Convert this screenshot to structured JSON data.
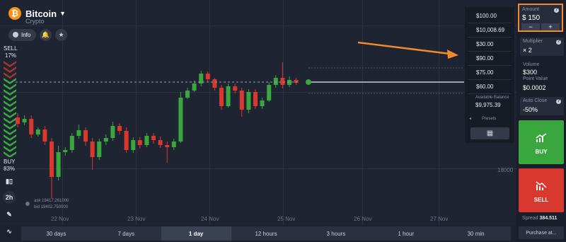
{
  "asset": {
    "name": "Bitcoin",
    "category": "Crypto",
    "logo_glyph": "₿"
  },
  "toolbar": {
    "info_label": "Info",
    "bell_icon": "bell-icon",
    "star_icon": "star-icon"
  },
  "sentiment": {
    "sell_label": "SELL",
    "sell_pct": "17%",
    "buy_label": "BUY",
    "buy_pct": "83%",
    "sell_color": "#a3332c",
    "buy_color": "#3aa63e"
  },
  "side_tools": {
    "timeframe": "2h"
  },
  "chart": {
    "x_labels": [
      "22 Nov",
      "23 Nov",
      "24 Nov",
      "25 Nov",
      "26 Nov",
      "27 Nov"
    ],
    "price_label": "18000",
    "ask": "ask 19417.261000",
    "bid": "bid 19402.750000"
  },
  "chart_data": {
    "type": "candlestick",
    "candles": [
      {
        "o": 166,
        "c": 175,
        "h": 160,
        "l": 180
      },
      {
        "o": 173,
        "c": 168,
        "h": 163,
        "l": 177
      },
      {
        "o": 168,
        "c": 190,
        "h": 163,
        "l": 195
      },
      {
        "o": 190,
        "c": 183,
        "h": 180,
        "l": 193
      },
      {
        "o": 183,
        "c": 200,
        "h": 178,
        "l": 205
      },
      {
        "o": 200,
        "c": 250,
        "h": 195,
        "l": 280
      },
      {
        "o": 250,
        "c": 215,
        "h": 206,
        "l": 255
      },
      {
        "o": 215,
        "c": 212,
        "h": 208,
        "l": 220
      },
      {
        "o": 212,
        "c": 192,
        "h": 188,
        "l": 216
      },
      {
        "o": 192,
        "c": 184,
        "h": 176,
        "l": 196
      },
      {
        "o": 184,
        "c": 200,
        "h": 180,
        "l": 206
      },
      {
        "o": 200,
        "c": 222,
        "h": 195,
        "l": 240
      },
      {
        "o": 222,
        "c": 200,
        "h": 196,
        "l": 226
      },
      {
        "o": 200,
        "c": 195,
        "h": 190,
        "l": 205
      },
      {
        "o": 195,
        "c": 178,
        "h": 172,
        "l": 199
      },
      {
        "o": 178,
        "c": 185,
        "h": 174,
        "l": 190
      },
      {
        "o": 185,
        "c": 212,
        "h": 180,
        "l": 216
      },
      {
        "o": 212,
        "c": 198,
        "h": 194,
        "l": 216
      },
      {
        "o": 198,
        "c": 205,
        "h": 194,
        "l": 210
      },
      {
        "o": 205,
        "c": 192,
        "h": 188,
        "l": 208
      },
      {
        "o": 192,
        "c": 198,
        "h": 188,
        "l": 203
      },
      {
        "o": 198,
        "c": 205,
        "h": 193,
        "l": 209
      },
      {
        "o": 205,
        "c": 208,
        "h": 200,
        "l": 230
      },
      {
        "o": 208,
        "c": 200,
        "h": 196,
        "l": 212
      },
      {
        "o": 200,
        "c": 138,
        "h": 130,
        "l": 202
      },
      {
        "o": 138,
        "c": 128,
        "h": 124,
        "l": 140
      },
      {
        "o": 128,
        "c": 118,
        "h": 114,
        "l": 130
      },
      {
        "o": 118,
        "c": 104,
        "h": 100,
        "l": 122
      },
      {
        "o": 104,
        "c": 112,
        "h": 101,
        "l": 116
      },
      {
        "o": 112,
        "c": 124,
        "h": 110,
        "l": 128
      },
      {
        "o": 124,
        "c": 150,
        "h": 120,
        "l": 155
      },
      {
        "o": 150,
        "c": 122,
        "h": 118,
        "l": 152
      },
      {
        "o": 122,
        "c": 128,
        "h": 118,
        "l": 132
      },
      {
        "o": 128,
        "c": 155,
        "h": 124,
        "l": 165
      },
      {
        "o": 155,
        "c": 130,
        "h": 126,
        "l": 160
      },
      {
        "o": 130,
        "c": 150,
        "h": 126,
        "l": 154
      },
      {
        "o": 150,
        "c": 142,
        "h": 138,
        "l": 154
      },
      {
        "o": 142,
        "c": 120,
        "h": 116,
        "l": 144
      },
      {
        "o": 120,
        "c": 110,
        "h": 106,
        "l": 124
      },
      {
        "o": 110,
        "c": 120,
        "h": 88,
        "l": 125
      },
      {
        "o": 120,
        "c": 113,
        "h": 108,
        "l": 123
      },
      {
        "o": 113,
        "c": 117,
        "h": 110,
        "l": 120
      }
    ],
    "up_color": "#3aa63e",
    "down_color": "#d9382f",
    "current_price_line": 116
  },
  "amounts": {
    "items": [
      "$100.00",
      "$10,008.69",
      "$30.00",
      "$90.00",
      "$75.00",
      "$60.00"
    ],
    "available_label": "Available Balance",
    "available_value": "$9,975.39",
    "presets_label": "Presets",
    "calc_icon": "calculator-icon"
  },
  "trade": {
    "amount_label": "Amount",
    "amount_value": "$ 150",
    "minus": "−",
    "plus": "+",
    "multiplier_label": "Multiplier",
    "multiplier_value": "× 2",
    "volume_label": "Volume",
    "volume_value": "$300",
    "point_value_label": "Point Value",
    "point_value_value": "$0.0002",
    "auto_close_label": "Auto Close",
    "auto_close_value": "-50%",
    "buy_label": "BUY",
    "sell_label": "SELL",
    "spread_label": "Spread",
    "spread_value": "384.511",
    "purchase_label": "Purchase at..."
  },
  "timeframes": [
    "30 days",
    "7 days",
    "1 day",
    "12 hours",
    "3 hours",
    "1 hour",
    "30 min"
  ],
  "timeframes_active": "1 day",
  "highlight_color": "#f38a2c"
}
